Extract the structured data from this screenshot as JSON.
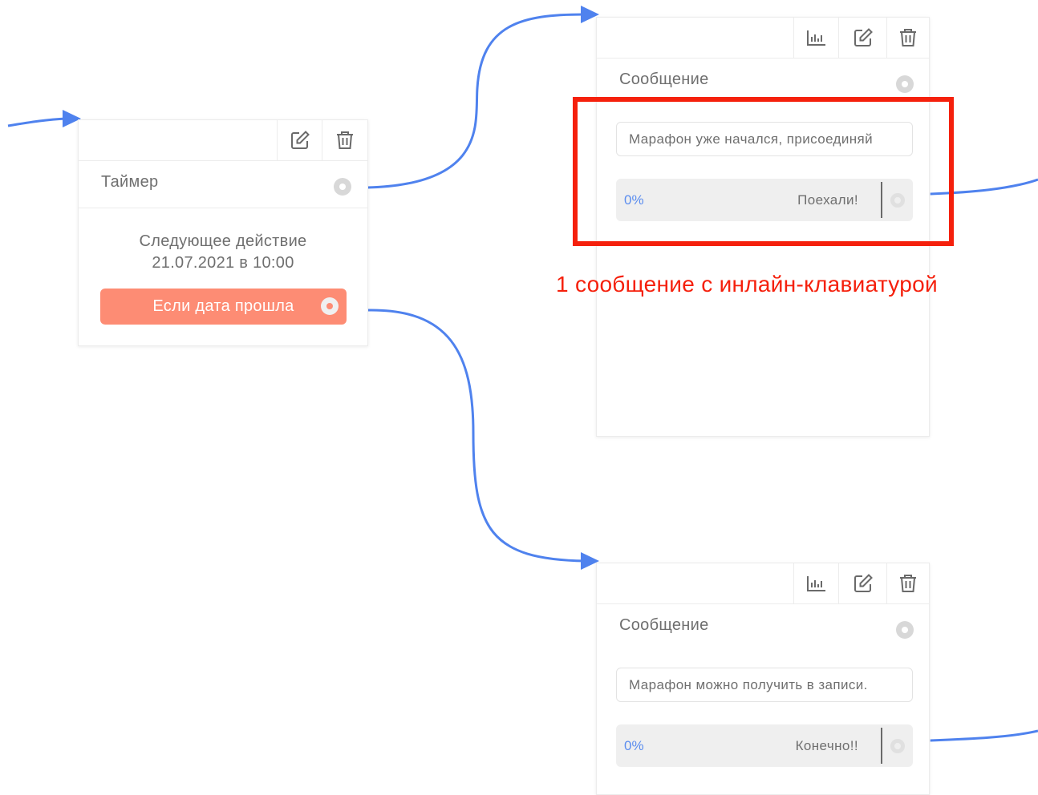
{
  "colors": {
    "connector": "#4f82ee",
    "accent_button": "#fd8c74",
    "highlight": "#f5200c",
    "percent_text": "#5b8def"
  },
  "timer_card": {
    "title": "Таймер",
    "next_action_label": "Следующее действие",
    "next_action_datetime": "21.07.2021 в 10:00",
    "if_passed_button": "Если дата прошла",
    "tools": [
      "edit-icon",
      "trash-icon"
    ]
  },
  "message_card_1": {
    "title": "Сообщение",
    "message_text": "Марафон уже начался, присоединяй",
    "keyboard_button": {
      "percent": "0%",
      "label": "Поехали!"
    },
    "tools": [
      "stats-icon",
      "edit-icon",
      "trash-icon"
    ]
  },
  "message_card_2": {
    "title": "Сообщение",
    "message_text": "Марафон можно получить в записи.",
    "keyboard_button": {
      "percent": "0%",
      "label": "Конечно!!"
    },
    "tools": [
      "stats-icon",
      "edit-icon",
      "trash-icon"
    ]
  },
  "annotation": {
    "text": "1 сообщение с инлайн-клавиатурой"
  }
}
